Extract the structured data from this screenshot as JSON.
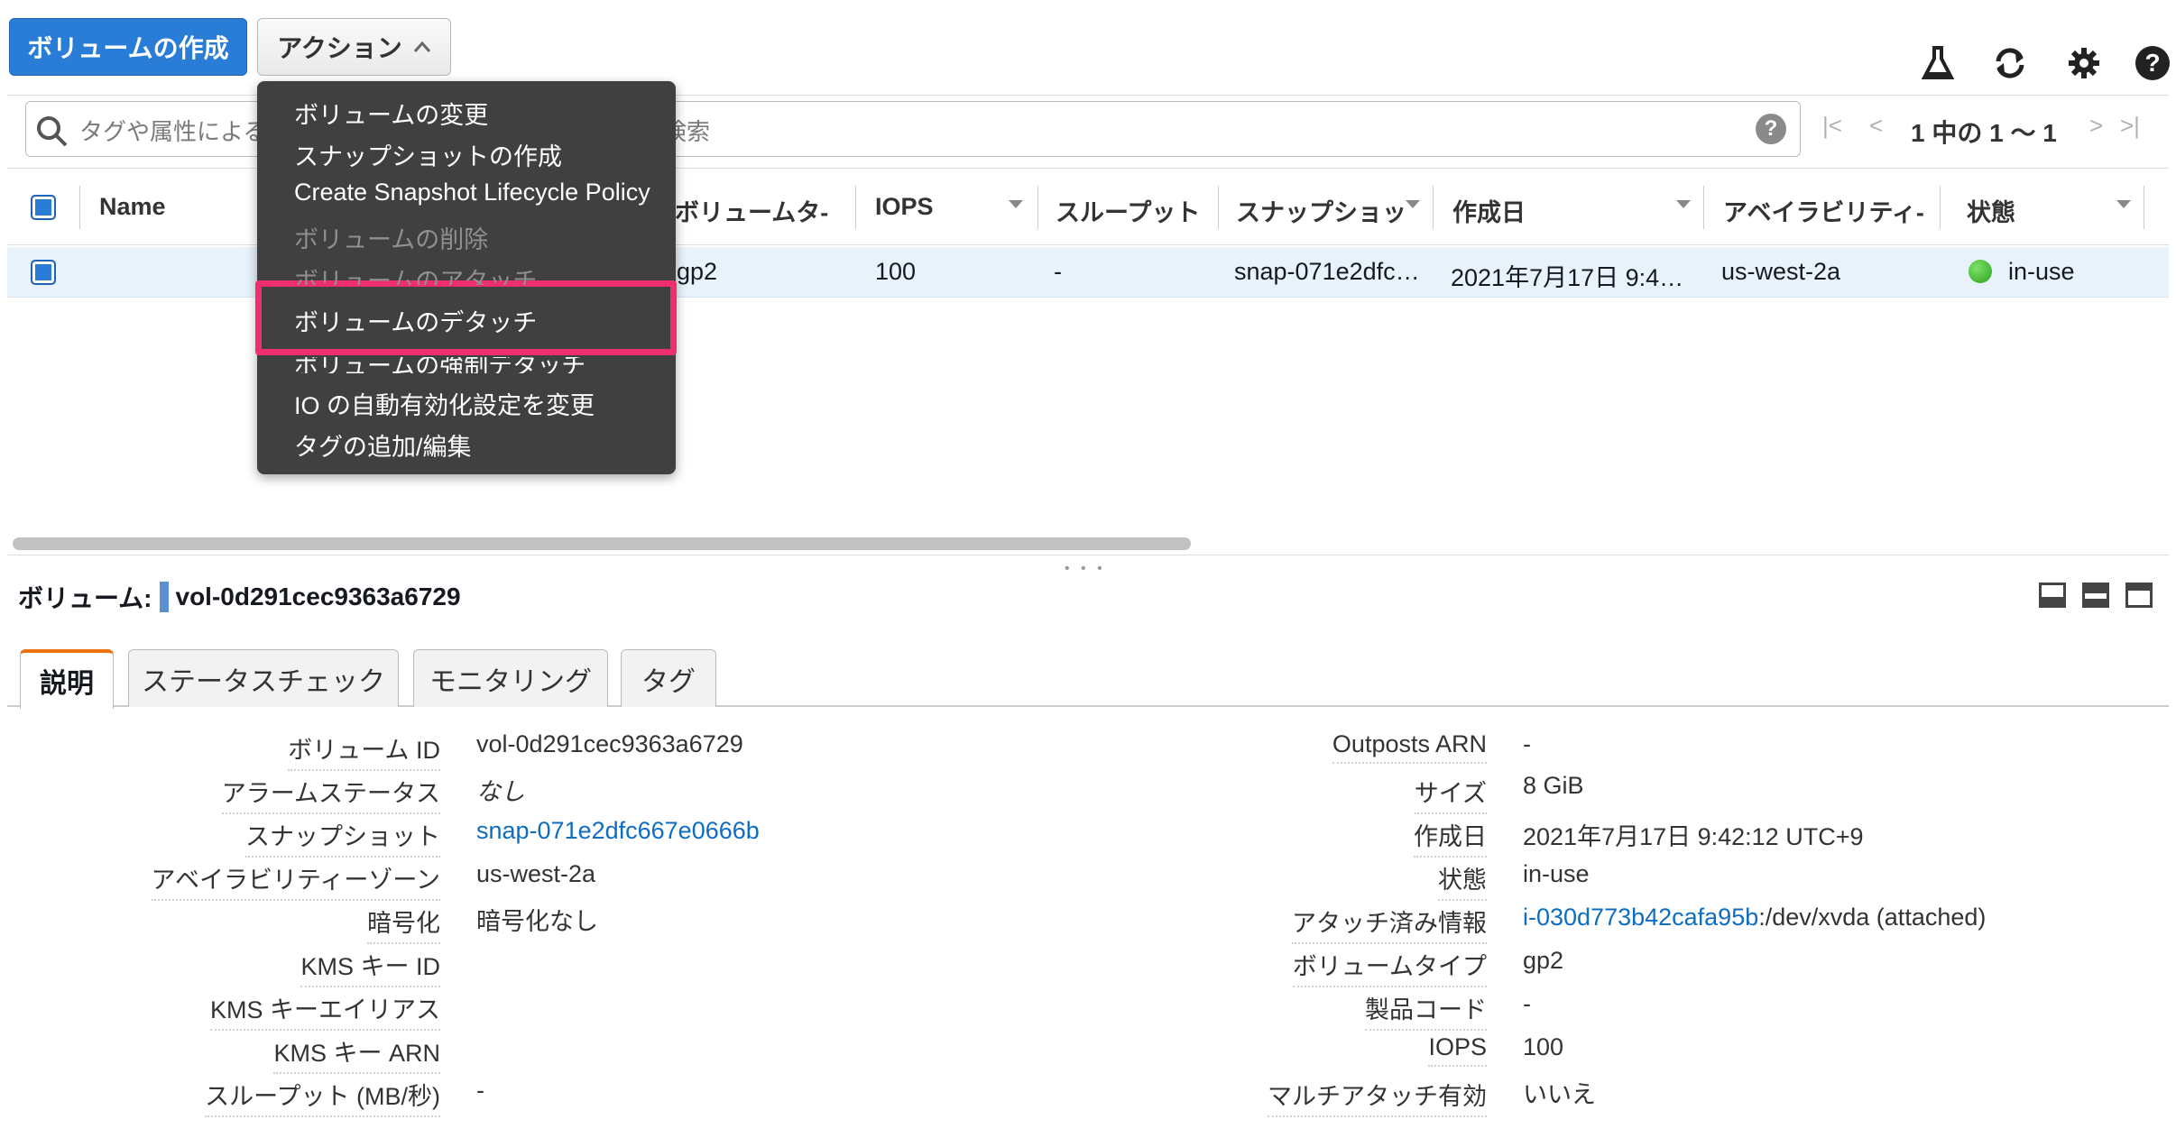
{
  "toolbar": {
    "create_label": "ボリュームの作成",
    "actions_label": "アクション"
  },
  "icons": {
    "flask": "flask-icon",
    "refresh": "refresh-icon",
    "settings": "gear-icon",
    "help": "help-icon"
  },
  "search": {
    "placeholder_left": "タグや属性による",
    "placeholder_right": "検索",
    "help": "?"
  },
  "pager": {
    "first": "|<",
    "prev": "<",
    "text": "1 中の 1 〜 1",
    "next": ">",
    "last": ">|"
  },
  "table": {
    "headers": [
      "Name",
      "ボリュームタ-",
      "IOPS",
      "スループット",
      "スナップショッ",
      "作成日",
      "アベイラビリティ-",
      "状態"
    ],
    "row": {
      "name": "",
      "volume_type": "gp2",
      "iops": "100",
      "throughput": "-",
      "snapshot": "snap-071e2dfc…",
      "created": "2021年7月17日 9:4…",
      "az": "us-west-2a",
      "state": "in-use"
    },
    "state_color": "#2aa31a"
  },
  "menu": {
    "items": [
      {
        "label": "ボリュームの変更",
        "disabled": false
      },
      {
        "label": "スナップショットの作成",
        "disabled": false
      },
      {
        "label": "Create Snapshot Lifecycle Policy",
        "disabled": false
      },
      {
        "label": "ボリュームの削除",
        "disabled": true
      },
      {
        "label": "ボリュームのアタッチ",
        "disabled": true
      },
      {
        "label": "ボリュームのデタッチ",
        "disabled": false
      },
      {
        "label": "ボリュームの強制デタッチ",
        "disabled": false
      },
      {
        "label": "IO の自動有効化設定を変更",
        "disabled": false
      },
      {
        "label": "タグの追加/編集",
        "disabled": false
      }
    ],
    "highlight_color": "#ee2e6e"
  },
  "detail": {
    "title_prefix": "ボリューム:",
    "title_id": "vol-0d291cec9363a6729",
    "tabs": [
      "説明",
      "ステータスチェック",
      "モニタリング",
      "タグ"
    ],
    "left": [
      {
        "label": "ボリューム ID",
        "value": "vol-0d291cec9363a6729",
        "link": false
      },
      {
        "label": "アラームステータス",
        "value": "なし",
        "link": false
      },
      {
        "label": "スナップショット",
        "value": "snap-071e2dfc667e0666b",
        "link": true
      },
      {
        "label": "アベイラビリティーゾーン",
        "value": "us-west-2a",
        "link": false
      },
      {
        "label": "暗号化",
        "value": "暗号化なし",
        "link": false
      },
      {
        "label": "KMS キー ID",
        "value": "",
        "link": false
      },
      {
        "label": "KMS キーエイリアス",
        "value": "",
        "link": false
      },
      {
        "label": "KMS キー ARN",
        "value": "",
        "link": false
      },
      {
        "label": "スループット (MB/秒)",
        "value": "-",
        "link": false
      }
    ],
    "right": [
      {
        "label": "Outposts ARN",
        "value": "-"
      },
      {
        "label": "サイズ",
        "value": "8 GiB"
      },
      {
        "label": "作成日",
        "value": "2021年7月17日 9:42:12 UTC+9"
      },
      {
        "label": "状態",
        "value": "in-use"
      },
      {
        "label": "アタッチ済み情報",
        "value_link": "i-030d773b42cafa95b",
        "value_rest": ":/dev/xvda (attached)"
      },
      {
        "label": "ボリュームタイプ",
        "value": "gp2"
      },
      {
        "label": "製品コード",
        "value": "-"
      },
      {
        "label": "IOPS",
        "value": "100"
      },
      {
        "label": "マルチアタッチ有効",
        "value": "いいえ"
      }
    ]
  }
}
